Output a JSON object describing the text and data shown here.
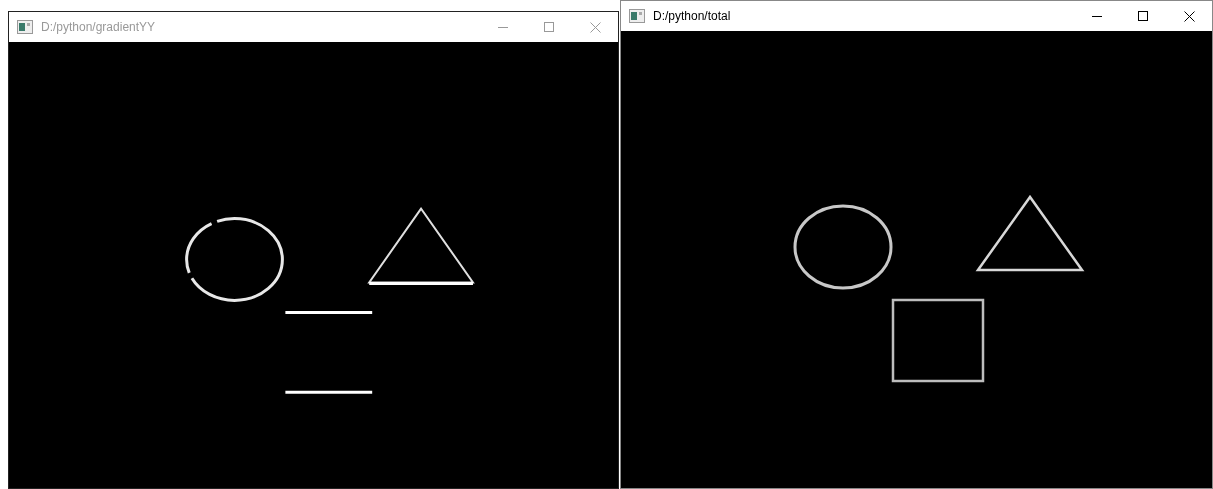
{
  "windows": [
    {
      "title": "D:/python/gradientYY",
      "active": false,
      "image": {
        "kind": "gradient"
      }
    },
    {
      "title": "D:/python/total",
      "active": true,
      "image": {
        "kind": "magnitude"
      }
    }
  ]
}
